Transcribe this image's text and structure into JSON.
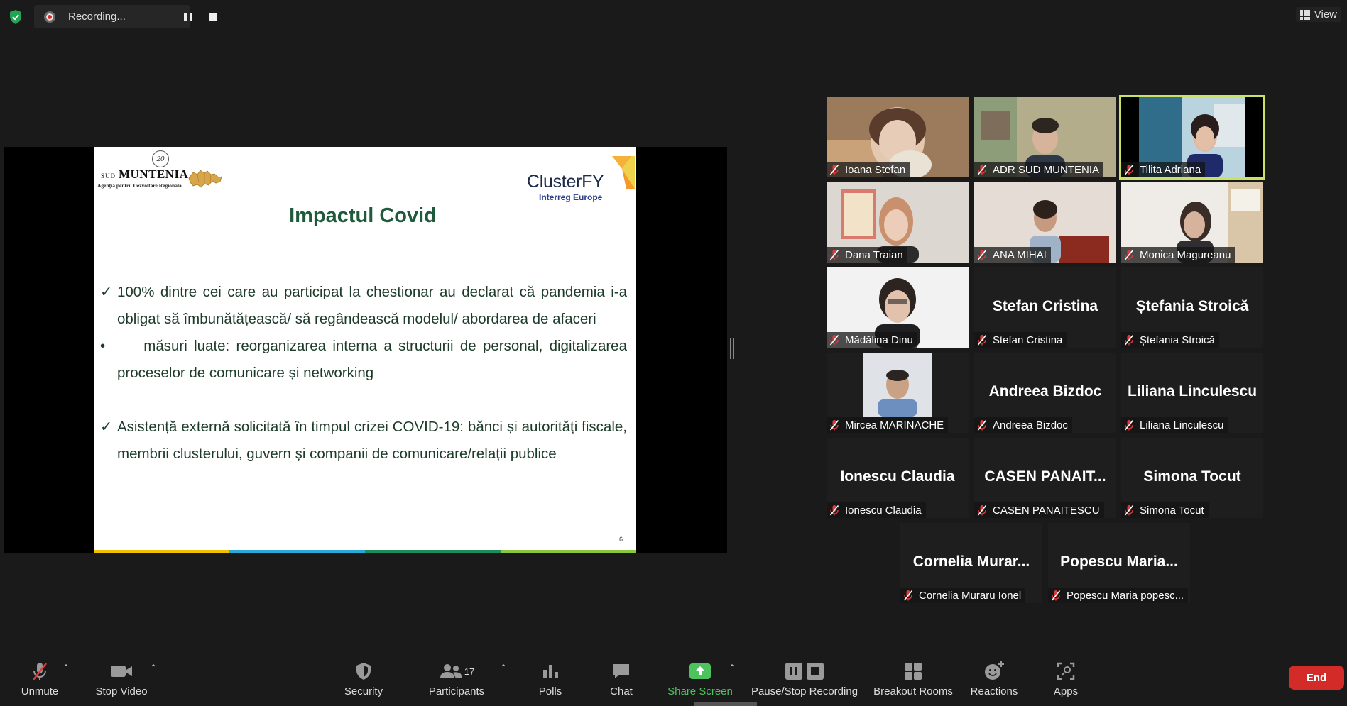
{
  "top": {
    "recording_label": "Recording...",
    "view_label": "View"
  },
  "slide": {
    "logo_left_number": "20",
    "logo_left_sud": "SUD",
    "logo_left_name": "MUNTENIA",
    "logo_left_agency": "Agenţia pentru Dezvoltare Regională",
    "logo_right_name": "ClusterFY",
    "logo_right_sub": "Interreg Europe",
    "title": "Impactul Covid",
    "p1_mark": "✓",
    "p1_text": "100% dintre cei care au participat la chestionar au declarat că pandemia i-a obligat să îmbunătățească/ să regândească  modelul/ abordarea de afaceri",
    "p2_mark": "•",
    "p2_text": "    măsuri luate: reorganizarea interna a structurii de personal, digitalizarea proceselor de comunicare și networking",
    "p3_mark": "✓",
    "p3_text": "Asistență externă solicitată în timpul crizei COVID-19: bănci și autorități fiscale,  membrii clusterului, guvern și companii de comunicare/relații publice",
    "page_number": "6",
    "stripe_colors": [
      "#f2c200",
      "#2aa8d8",
      "#1f8a5a",
      "#8cc63f"
    ]
  },
  "participants": [
    {
      "name": "Ioana Stefan",
      "video": true,
      "active": false
    },
    {
      "name": "ADR SUD MUNTENIA",
      "video": true,
      "active": false
    },
    {
      "name": "Tilita Adriana",
      "video": true,
      "active": true
    },
    {
      "name": "Dana Traian",
      "video": true,
      "active": false
    },
    {
      "name": "ANA MIHAI",
      "video": true,
      "active": false
    },
    {
      "name": "Monica Magureanu",
      "video": true,
      "active": false
    },
    {
      "name": "Mădălina Dinu",
      "video": true,
      "active": false
    },
    {
      "name": "Stefan Cristina",
      "big": "Stefan Cristina",
      "video": false
    },
    {
      "name": "Ștefania Stroică",
      "big": "Ștefania Stroică",
      "video": false
    },
    {
      "name": "Mircea MARINACHE",
      "video": true,
      "photo": true
    },
    {
      "name": "Andreea Bizdoc",
      "big": "Andreea Bizdoc",
      "video": false
    },
    {
      "name": "Liliana Linculescu",
      "big": "Liliana Linculescu",
      "video": false
    },
    {
      "name": "Ionescu Claudia",
      "big": "Ionescu Claudia",
      "video": false
    },
    {
      "name": "CASEN PANAITESCU",
      "big": "CASEN  PANAIT...",
      "video": false
    },
    {
      "name": "Simona Tocut",
      "big": "Simona Tocut",
      "video": false
    },
    {
      "name": "Cornelia Muraru Ionel",
      "big": "Cornelia  Murar...",
      "video": false
    },
    {
      "name": "Popescu Maria popesc...",
      "big": "Popescu  Maria...",
      "video": false
    }
  ],
  "toolbar": {
    "unmute": "Unmute",
    "stop_video": "Stop Video",
    "security": "Security",
    "participants": "Participants",
    "participants_count": "17",
    "polls": "Polls",
    "chat": "Chat",
    "share_screen": "Share Screen",
    "pause_stop_recording": "Pause/Stop Recording",
    "breakout_rooms": "Breakout Rooms",
    "reactions": "Reactions",
    "apps": "Apps",
    "end": "End"
  },
  "colors": {
    "accent_green": "#4cc35c",
    "end_red": "#d32b27",
    "active_speaker": "#c9e265"
  }
}
